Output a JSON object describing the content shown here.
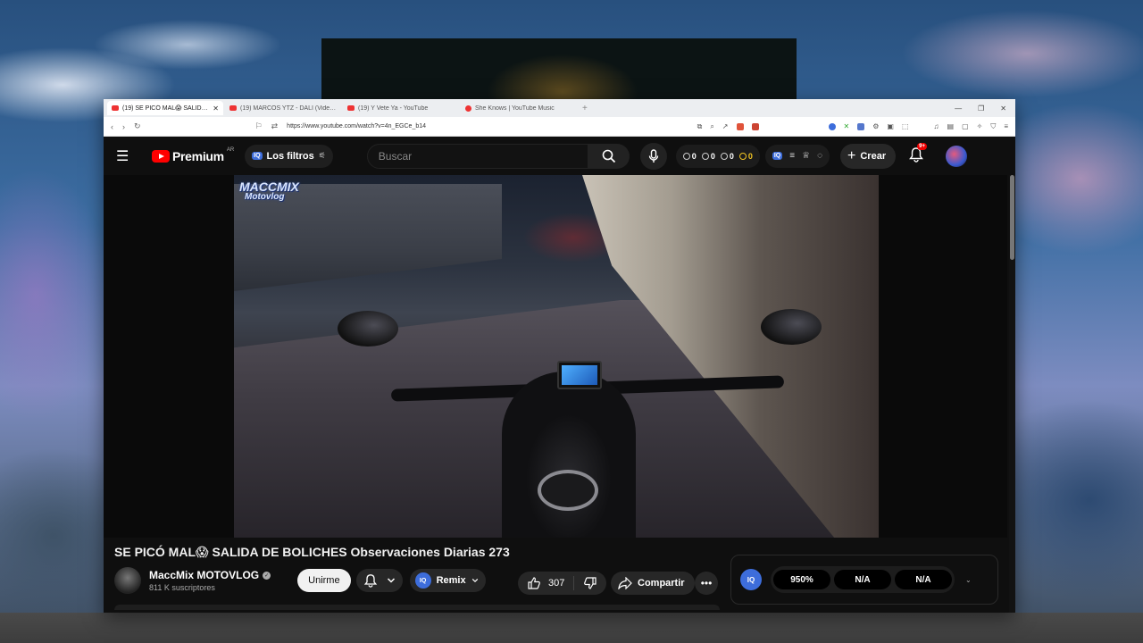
{
  "browser": {
    "tabs": [
      {
        "label": "(19) SE PICÓ MAL😱 SALIDA...",
        "active": true
      },
      {
        "label": "(19) MARCOS YTZ - DALI (Video Ofi...",
        "active": false
      },
      {
        "label": "(19) Y Vete Ya - YouTube",
        "active": false
      },
      {
        "label": "She Knows | YouTube Music",
        "active": false
      }
    ],
    "url": "https://www.youtube.com/watch?v=4n_EGCe_b14"
  },
  "youtube": {
    "brand": "Premium",
    "region": "AR",
    "filters_label": "Los filtros",
    "iq_badge": "IQ",
    "search_placeholder": "Buscar",
    "stats": [
      "0",
      "0",
      "0",
      "0"
    ],
    "create_label": "Crear",
    "notifications_badge": "9+"
  },
  "video": {
    "overlay_logo_line1": "MACCMIX",
    "overlay_logo_line2": "Motovlog",
    "title": "SE PICÓ MAL😱 SALIDA DE BOLICHES Observaciones Diarias 273"
  },
  "channel": {
    "name": "MaccMix MOTOVLOG",
    "subscribers": "811 K suscriptores",
    "join_label": "Unirme",
    "remix_label": "Remix"
  },
  "actions": {
    "likes": "307",
    "share_label": "Compartir"
  },
  "iq_panel": {
    "values": [
      "950%",
      "N/A",
      "N/A"
    ]
  },
  "colors": {
    "accent_red": "#ff0000",
    "iq_blue": "#3d6ddb",
    "stat_yellow": "#f3c623"
  }
}
